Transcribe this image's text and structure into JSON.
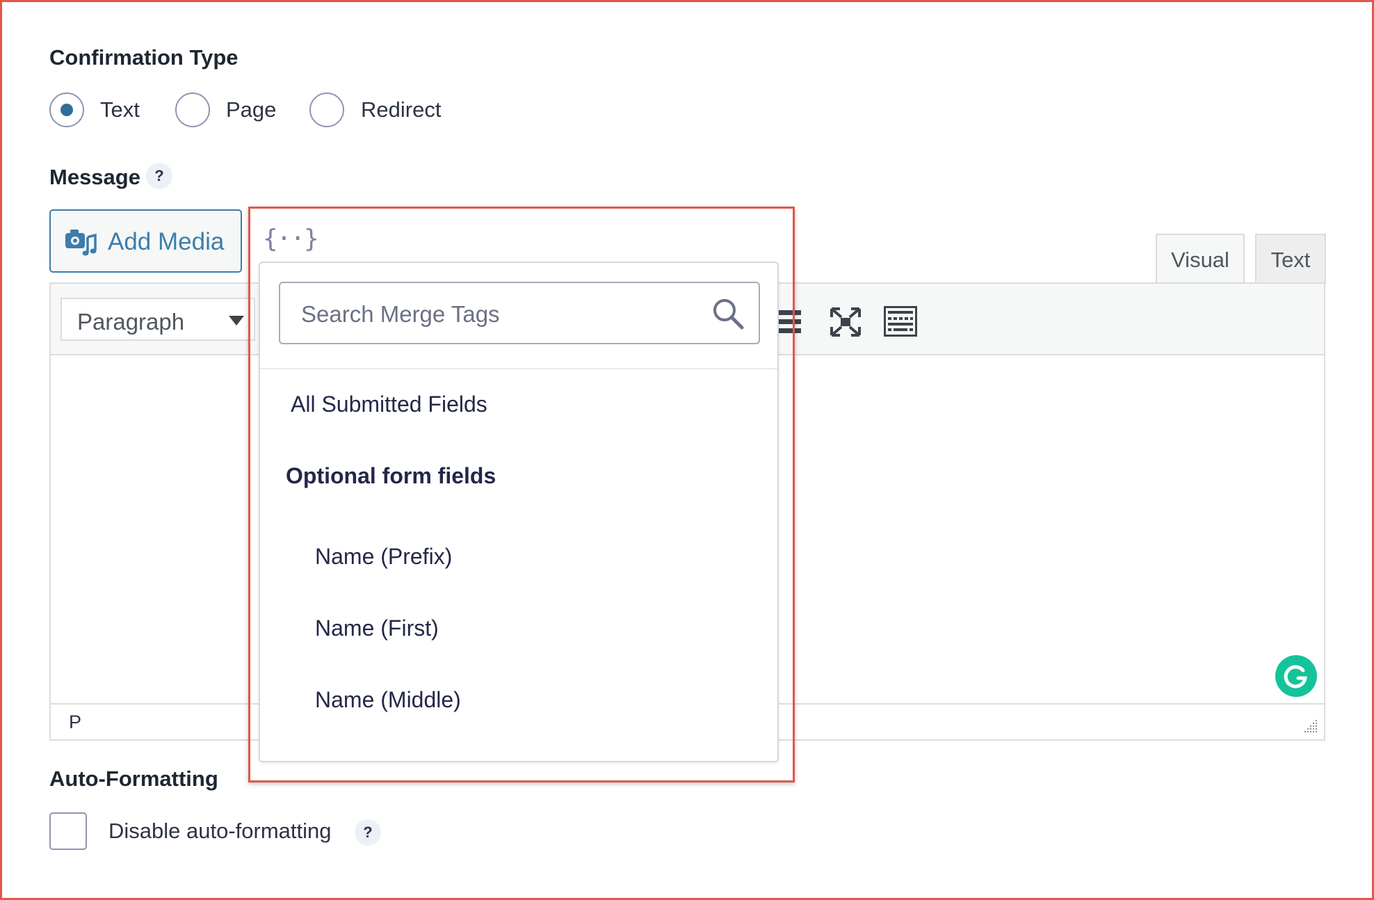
{
  "confirmation_type": {
    "title": "Confirmation Type",
    "options": [
      {
        "label": "Text",
        "selected": true
      },
      {
        "label": "Page",
        "selected": false
      },
      {
        "label": "Redirect",
        "selected": false
      }
    ]
  },
  "message": {
    "title": "Message",
    "help_icon": "?",
    "add_media_label": "Add Media",
    "merge_tags_icon": "{··}",
    "tabs": {
      "visual": "Visual",
      "text": "Text"
    },
    "format_select": "Paragraph",
    "status_path": "P"
  },
  "merge_tags": {
    "search_placeholder": "Search Merge Tags",
    "items": [
      {
        "label": "All Submitted Fields"
      }
    ],
    "group_label": "Optional form fields",
    "group_items": [
      {
        "label": "Name (Prefix)"
      },
      {
        "label": "Name (First)"
      },
      {
        "label": "Name (Middle)"
      }
    ]
  },
  "auto_formatting": {
    "title": "Auto-Formatting",
    "checkbox_label": "Disable auto-formatting",
    "checked": false,
    "help_icon": "?"
  },
  "colors": {
    "accent": "#3c7dab",
    "highlight_border": "#e2574c",
    "grammarly": "#15c39a"
  }
}
